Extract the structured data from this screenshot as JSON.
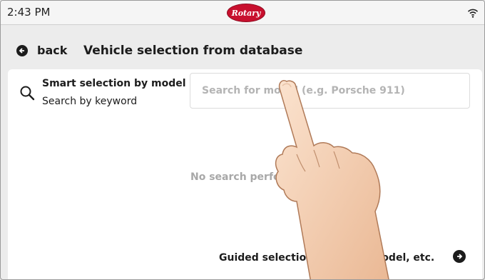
{
  "status": {
    "time": "2:43 PM",
    "logo_text": "Rotary",
    "wifi_icon": "wifi-icon",
    "brand_color": "#c8102e"
  },
  "header": {
    "back_label": "back",
    "title": "Vehicle selection from database"
  },
  "smart": {
    "title": "Smart selection by model",
    "subtitle": "Search by keyword",
    "icon": "search-icon"
  },
  "search": {
    "placeholder": "Search for model (e.g. Porsche 911)",
    "value": ""
  },
  "results": {
    "empty_text": "No search performed"
  },
  "guided": {
    "label": "Guided selection by make, model, etc.",
    "icon": "arrow-right-circle-icon"
  }
}
